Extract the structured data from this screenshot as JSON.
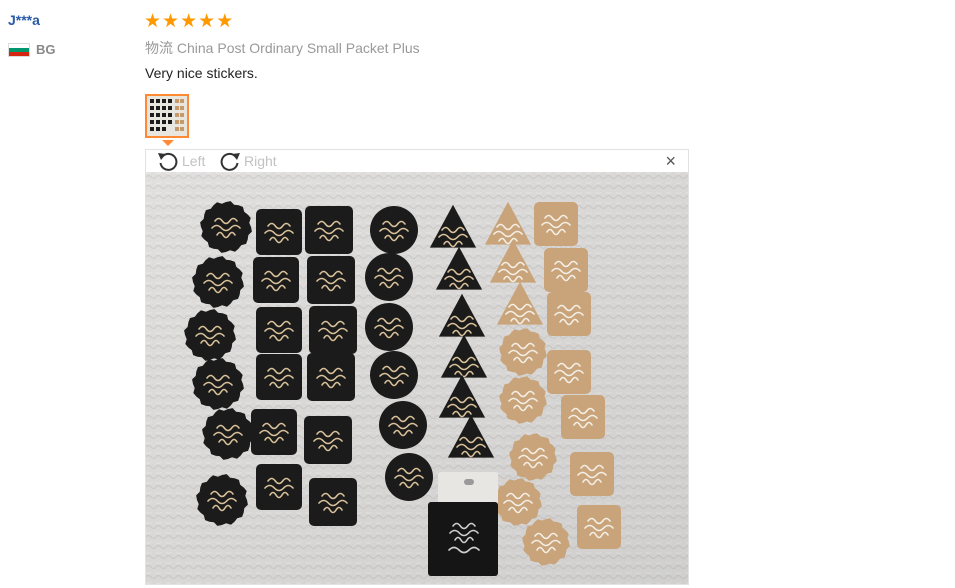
{
  "review": {
    "user": "J***a",
    "country": "BG",
    "rating": 5,
    "shipping_label": "物流",
    "shipping_method": "China Post Ordinary Small Packet Plus",
    "text": "Very nice stickers."
  },
  "viewer": {
    "rotate_left_label": "Left",
    "rotate_right_label": "Right",
    "close_label": "×"
  },
  "colors": {
    "username": "#2a5aa8",
    "star": "#ff9900",
    "thumb_border": "#ff8a33",
    "flag": [
      "#ffffff",
      "#00966e",
      "#d62612"
    ]
  },
  "icons": {
    "rotate_left": "rotate-left-icon",
    "rotate_right": "rotate-right-icon",
    "close": "close-icon"
  }
}
